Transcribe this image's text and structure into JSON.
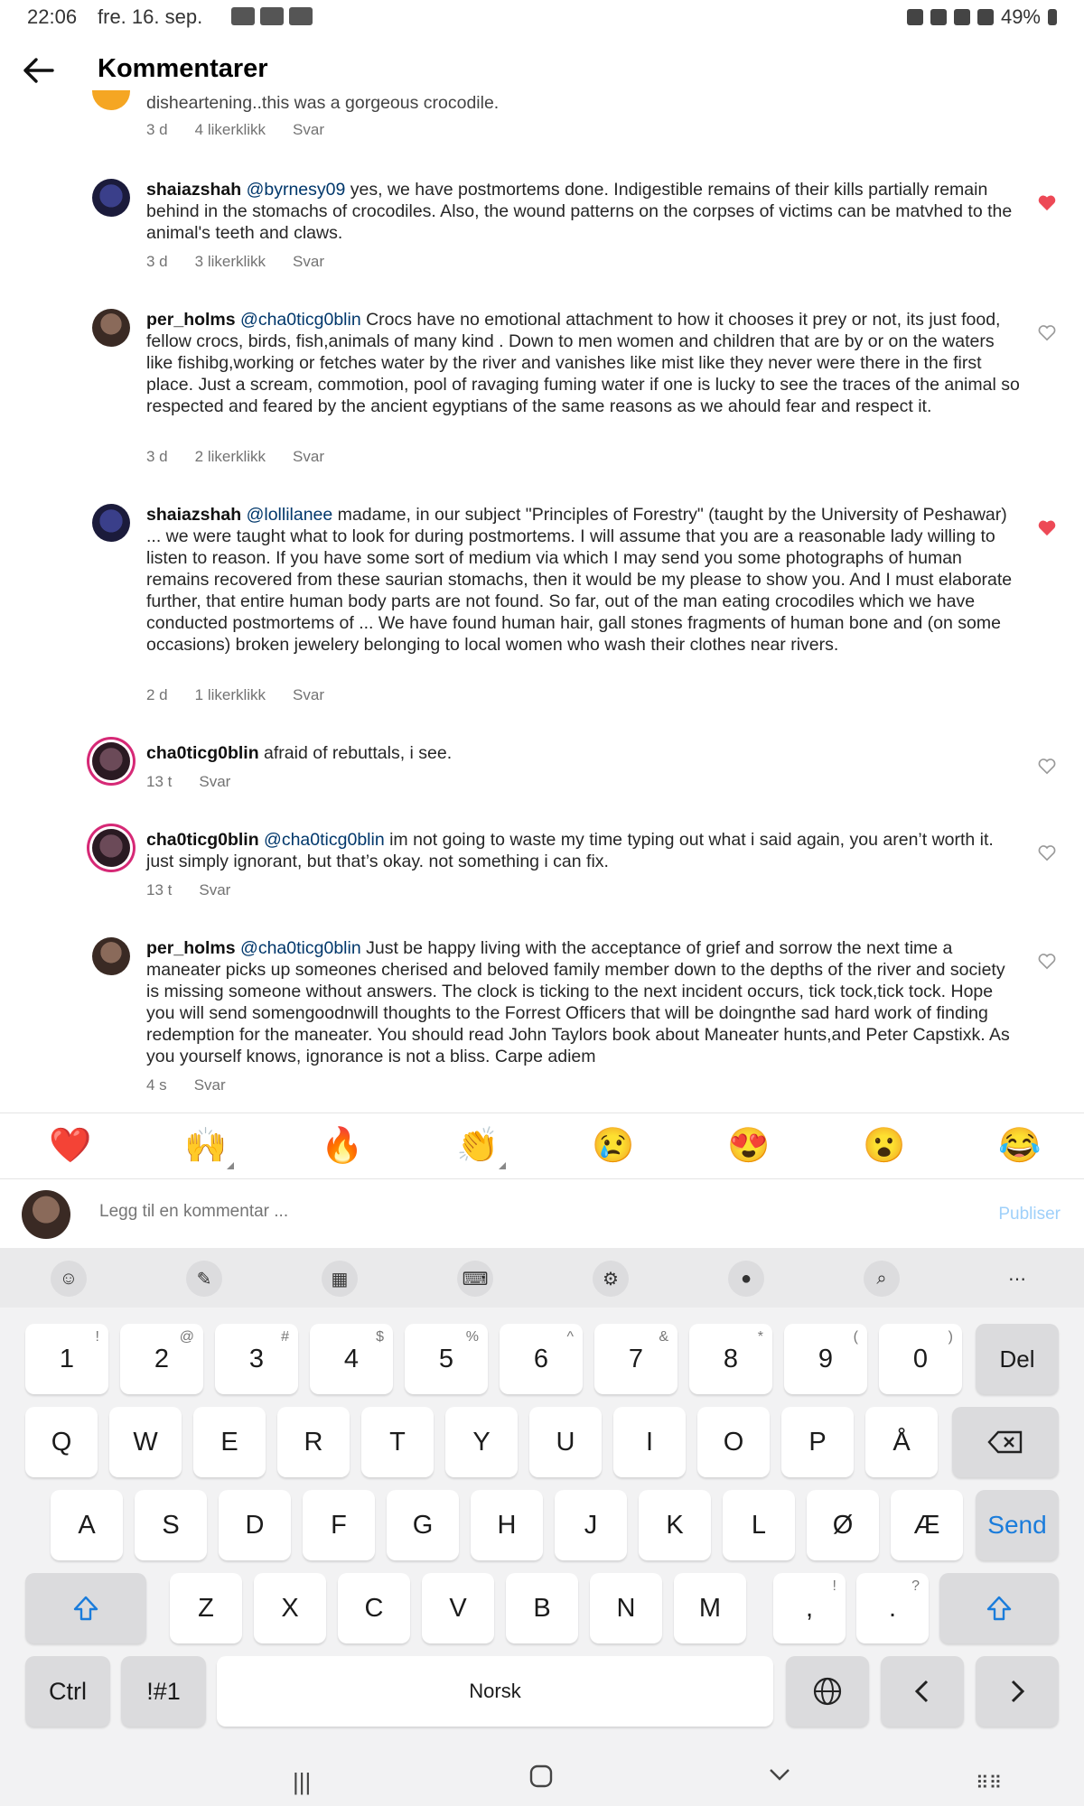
{
  "status_bar": {
    "time": "22:06",
    "date": "fre. 16. sep.",
    "battery": "49%"
  },
  "header": {
    "title": "Kommentarer"
  },
  "comments": [
    {
      "text": "disheartening..this was a gorgeous crocodile.",
      "age": "3 d",
      "likes": "4 likerklikk",
      "reply": "Svar"
    },
    {
      "user": "shaiazshah",
      "mention": "@byrnesy09",
      "text": "yes, we have postmortems done. Indigestible remains of their kills partially remain behind in the stomachs of crocodiles. Also, the wound patterns on the corpses of victims can be matvhed to the animal's teeth and claws.",
      "age": "3 d",
      "likes": "3 likerklikk",
      "reply": "Svar"
    },
    {
      "user": "per_holms",
      "mention": "@cha0ticg0blin",
      "text": "Crocs have no emotional attachment to how it chooses it prey or not, its just food, fellow crocs, birds, fish,animals of many kind . Down to men  women and children that are by or on the waters like fishibg,working or fetches water by the river and vanishes like mist like they never were there in the first place.  Just a scream, commotion, pool of ravaging fuming water if one is lucky to see the traces of the animal so respected and feared by the ancient egyptians of the same reasons as we ahould fear and respect it.",
      "age": "3 d",
      "likes": "2 likerklikk",
      "reply": "Svar"
    },
    {
      "user": "shaiazshah",
      "mention": "@lollilanee",
      "text": "madame, in our subject \"Principles of Forestry\" (taught by the University of Peshawar) ... we were taught what to look for during postmortems. I will assume that you are a reasonable lady willing to listen to reason. If you have some sort of medium via which I may send you some photographs of human remains recovered from these saurian stomachs, then it would be my please to show you. And  I must elaborate further, that entire human body parts are not found. So far, out of the man eating crocodiles which we have conducted postmortems of ... We have found human hair, gall stones fragments of human bone and (on some occasions) broken jewelery belonging to local women who wash their clothes near rivers.",
      "age": "2 d",
      "likes": "1 likerklikk",
      "reply": "Svar"
    },
    {
      "user": "cha0ticg0blin",
      "mention": "",
      "text": "afraid of rebuttals, i see.",
      "age": "13 t",
      "likes": "",
      "reply": "Svar"
    },
    {
      "user": "cha0ticg0blin",
      "mention": "@cha0ticg0blin",
      "text": "im not going to waste my time typing out what i said again, you aren’t worth it. just simply ignorant, but that’s okay. not something i can fix.",
      "age": "13 t",
      "likes": "",
      "reply": "Svar"
    },
    {
      "user": "per_holms",
      "mention": "@cha0ticg0blin",
      "text": " Just be happy living with the acceptance of grief and sorrow the next time a maneater picks up someones cherised and beloved family member down to the depths of the river and society is missing someone without answers. The clock is ticking to the next incident occurs, tick tock,tick tock. Hope you will send somengoodnwill thoughts to the Forrest Officers that will be doingnthe sad hard work of finding redemption for the maneater. You should read John Taylors book about Maneater hunts,and Peter Capstixk. As you yourself knows, ignorance is not a bliss. Carpe adiem",
      "age": "4 s",
      "likes": "",
      "reply": "Svar"
    }
  ],
  "reactions": [
    "❤️",
    "🙌",
    "🔥",
    "👏",
    "😢",
    "😍",
    "😮",
    "😂"
  ],
  "compose": {
    "placeholder": "Legg til en kommentar ...",
    "publish": "Publiser"
  },
  "keyboard": {
    "row1": [
      {
        "k": "1",
        "s": "!"
      },
      {
        "k": "2",
        "s": "@"
      },
      {
        "k": "3",
        "s": "#"
      },
      {
        "k": "4",
        "s": "$"
      },
      {
        "k": "5",
        "s": "%"
      },
      {
        "k": "6",
        "s": "^"
      },
      {
        "k": "7",
        "s": "&"
      },
      {
        "k": "8",
        "s": "*"
      },
      {
        "k": "9",
        "s": "("
      },
      {
        "k": "0",
        "s": ")"
      }
    ],
    "del": "Del",
    "row2": [
      "Q",
      "W",
      "E",
      "R",
      "T",
      "Y",
      "U",
      "I",
      "O",
      "P",
      "Å"
    ],
    "row3": [
      "A",
      "S",
      "D",
      "F",
      "G",
      "H",
      "J",
      "K",
      "L",
      "Ø",
      "Æ"
    ],
    "send": "Send",
    "row4": [
      "Z",
      "X",
      "C",
      "V",
      "B",
      "N",
      "M"
    ],
    "comma": ",",
    "comma_sup": "!",
    "period": ".",
    "period_sup": "?",
    "ctrl": "Ctrl",
    "sym": "!#1",
    "space": "Norsk"
  }
}
